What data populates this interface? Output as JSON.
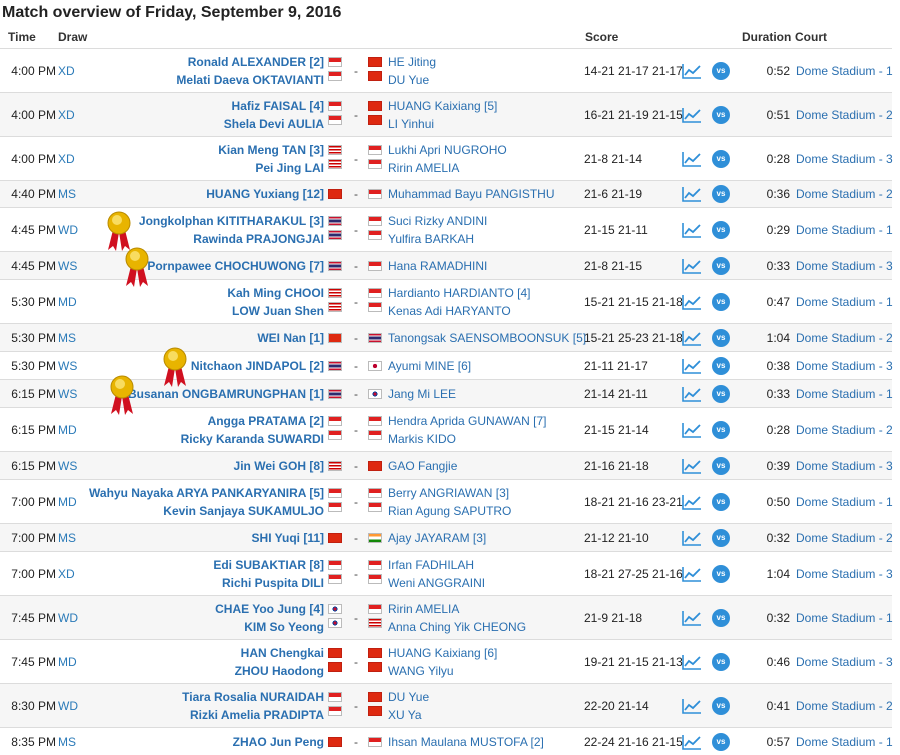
{
  "title": "Match overview of Friday, September 9, 2016",
  "columns": {
    "time": "Time",
    "draw": "Draw",
    "score": "Score",
    "duration": "Duration",
    "court": "Court"
  },
  "vs_label": "vs",
  "separator": "-",
  "colors": {
    "link": "#2a6fb0",
    "vs_badge": "#2f8fd8",
    "stripe": "#f6f6f6",
    "divider": "#dcdcdc",
    "medal_gold": "#e8b400",
    "ribbon": "#d01020"
  },
  "icons": {
    "stats": "line-chart-icon",
    "head_to_head": "vs-icon",
    "winner": "gold-medal-icon"
  },
  "matches": [
    {
      "time": "4:00 PM",
      "draw": "XD",
      "home": [
        {
          "name": "Ronald ALEXANDER [2]",
          "flag": "INA"
        },
        {
          "name": "Melati Daeva OKTAVIANTI",
          "flag": "INA"
        }
      ],
      "away": [
        {
          "name": "HE Jiting",
          "flag": "CHN"
        },
        {
          "name": "DU Yue",
          "flag": "CHN"
        }
      ],
      "score": "14-21 21-17 21-17",
      "duration": "0:52",
      "court": "Dome Stadium - 1"
    },
    {
      "time": "4:00 PM",
      "draw": "XD",
      "home": [
        {
          "name": "Hafiz FAISAL [4]",
          "flag": "INA"
        },
        {
          "name": "Shela Devi AULIA",
          "flag": "INA"
        }
      ],
      "away": [
        {
          "name": "HUANG Kaixiang [5]",
          "flag": "CHN"
        },
        {
          "name": "LI Yinhui",
          "flag": "CHN"
        }
      ],
      "score": "16-21 21-19 21-15",
      "duration": "0:51",
      "court": "Dome Stadium - 2"
    },
    {
      "time": "4:00 PM",
      "draw": "XD",
      "home": [
        {
          "name": "Kian Meng TAN [3]",
          "flag": "MAS"
        },
        {
          "name": "Pei Jing LAI",
          "flag": "MAS"
        }
      ],
      "away": [
        {
          "name": "Lukhi Apri NUGROHO",
          "flag": "INA"
        },
        {
          "name": "Ririn AMELIA",
          "flag": "INA"
        }
      ],
      "score": "21-8 21-14",
      "duration": "0:28",
      "court": "Dome Stadium - 3"
    },
    {
      "time": "4:40 PM",
      "draw": "MS",
      "home": [
        {
          "name": "HUANG Yuxiang [12]",
          "flag": "CHN"
        }
      ],
      "away": [
        {
          "name": "Muhammad Bayu PANGISTHU",
          "flag": "INA"
        }
      ],
      "score": "21-6 21-19",
      "duration": "0:36",
      "court": "Dome Stadium - 2"
    },
    {
      "time": "4:45 PM",
      "draw": "WD",
      "medal": true,
      "home": [
        {
          "name": "Jongkolphan KITITHARAKUL [3]",
          "flag": "THA"
        },
        {
          "name": "Rawinda PRAJONGJAI",
          "flag": "THA"
        }
      ],
      "away": [
        {
          "name": "Suci Rizky ANDINI",
          "flag": "INA"
        },
        {
          "name": "Yulfira BARKAH",
          "flag": "INA"
        }
      ],
      "score": "21-15 21-11",
      "duration": "0:29",
      "court": "Dome Stadium - 1"
    },
    {
      "time": "4:45 PM",
      "draw": "WS",
      "medal": true,
      "home": [
        {
          "name": "Pornpawee CHOCHUWONG [7]",
          "flag": "THA"
        }
      ],
      "away": [
        {
          "name": "Hana RAMADHINI",
          "flag": "INA"
        }
      ],
      "score": "21-8 21-15",
      "duration": "0:33",
      "court": "Dome Stadium - 3"
    },
    {
      "time": "5:30 PM",
      "draw": "MD",
      "home": [
        {
          "name": "Kah Ming CHOOI",
          "flag": "MAS"
        },
        {
          "name": "LOW Juan Shen",
          "flag": "MAS"
        }
      ],
      "away": [
        {
          "name": "Hardianto HARDIANTO [4]",
          "flag": "INA"
        },
        {
          "name": "Kenas Adi HARYANTO",
          "flag": "INA"
        }
      ],
      "score": "15-21 21-15 21-18",
      "duration": "0:47",
      "court": "Dome Stadium - 1"
    },
    {
      "time": "5:30 PM",
      "draw": "MS",
      "home": [
        {
          "name": "WEI Nan [1]",
          "flag": "HKG"
        }
      ],
      "away": [
        {
          "name": "Tanongsak SAENSOMBOONSUK [5]",
          "flag": "THA"
        }
      ],
      "score": "15-21 25-23 21-18",
      "duration": "1:04",
      "court": "Dome Stadium - 2"
    },
    {
      "time": "5:30 PM",
      "draw": "WS",
      "medal": true,
      "home": [
        {
          "name": "Nitchaon JINDAPOL [2]",
          "flag": "THA"
        }
      ],
      "away": [
        {
          "name": "Ayumi MINE [6]",
          "flag": "JPN"
        }
      ],
      "score": "21-11 21-17",
      "duration": "0:38",
      "court": "Dome Stadium - 3"
    },
    {
      "time": "6:15 PM",
      "draw": "WS",
      "medal": true,
      "home": [
        {
          "name": "Busanan ONGBAMRUNGPHAN [1]",
          "flag": "THA"
        }
      ],
      "away": [
        {
          "name": "Jang Mi LEE",
          "flag": "KOR"
        }
      ],
      "score": "21-14 21-11",
      "duration": "0:33",
      "court": "Dome Stadium - 1"
    },
    {
      "time": "6:15 PM",
      "draw": "MD",
      "home": [
        {
          "name": "Angga PRATAMA [2]",
          "flag": "INA"
        },
        {
          "name": "Ricky Karanda SUWARDI",
          "flag": "INA"
        }
      ],
      "away": [
        {
          "name": "Hendra Aprida GUNAWAN [7]",
          "flag": "INA"
        },
        {
          "name": "Markis KIDO",
          "flag": "INA"
        }
      ],
      "score": "21-15 21-14",
      "duration": "0:28",
      "court": "Dome Stadium - 2"
    },
    {
      "time": "6:15 PM",
      "draw": "WS",
      "home": [
        {
          "name": "Jin Wei GOH [8]",
          "flag": "MAS"
        }
      ],
      "away": [
        {
          "name": "GAO Fangjie",
          "flag": "CHN"
        }
      ],
      "score": "21-16 21-18",
      "duration": "0:39",
      "court": "Dome Stadium - 3"
    },
    {
      "time": "7:00 PM",
      "draw": "MD",
      "home": [
        {
          "name": "Wahyu Nayaka ARYA PANKARYANIRA [5]",
          "flag": "INA"
        },
        {
          "name": "Kevin Sanjaya SUKAMULJO",
          "flag": "INA"
        }
      ],
      "away": [
        {
          "name": "Berry ANGRIAWAN [3]",
          "flag": "INA"
        },
        {
          "name": "Rian Agung SAPUTRO",
          "flag": "INA"
        }
      ],
      "score": "18-21 21-16 23-21",
      "duration": "0:50",
      "court": "Dome Stadium - 1"
    },
    {
      "time": "7:00 PM",
      "draw": "MS",
      "home": [
        {
          "name": "SHI Yuqi [11]",
          "flag": "CHN"
        }
      ],
      "away": [
        {
          "name": "Ajay JAYARAM [3]",
          "flag": "IND"
        }
      ],
      "score": "21-12 21-10",
      "duration": "0:32",
      "court": "Dome Stadium - 2"
    },
    {
      "time": "7:00 PM",
      "draw": "XD",
      "home": [
        {
          "name": "Edi SUBAKTIAR [8]",
          "flag": "INA"
        },
        {
          "name": "Richi Puspita DILI",
          "flag": "INA"
        }
      ],
      "away": [
        {
          "name": "Irfan FADHILAH",
          "flag": "INA"
        },
        {
          "name": "Weni ANGGRAINI",
          "flag": "INA"
        }
      ],
      "score": "18-21 27-25 21-16",
      "duration": "1:04",
      "court": "Dome Stadium - 3"
    },
    {
      "time": "7:45 PM",
      "draw": "WD",
      "home": [
        {
          "name": "CHAE Yoo Jung [4]",
          "flag": "KOR"
        },
        {
          "name": "KIM So Yeong",
          "flag": "KOR"
        }
      ],
      "away": [
        {
          "name": "Ririn AMELIA",
          "flag": "INA"
        },
        {
          "name": "Anna Ching Yik CHEONG",
          "flag": "MAS"
        }
      ],
      "score": "21-9 21-18",
      "duration": "0:32",
      "court": "Dome Stadium - 1"
    },
    {
      "time": "7:45 PM",
      "draw": "MD",
      "home": [
        {
          "name": "HAN Chengkai",
          "flag": "CHN"
        },
        {
          "name": "ZHOU Haodong",
          "flag": "CHN"
        }
      ],
      "away": [
        {
          "name": "HUANG Kaixiang [6]",
          "flag": "CHN"
        },
        {
          "name": "WANG Yilyu",
          "flag": "CHN"
        }
      ],
      "score": "19-21 21-15 21-13",
      "duration": "0:46",
      "court": "Dome Stadium - 3"
    },
    {
      "time": "8:30 PM",
      "draw": "WD",
      "home": [
        {
          "name": "Tiara Rosalia NURAIDAH",
          "flag": "INA"
        },
        {
          "name": "Rizki Amelia PRADIPTA",
          "flag": "INA"
        }
      ],
      "away": [
        {
          "name": "DU Yue",
          "flag": "CHN"
        },
        {
          "name": "XU Ya",
          "flag": "CHN"
        }
      ],
      "score": "22-20 21-14",
      "duration": "0:41",
      "court": "Dome Stadium - 2"
    },
    {
      "time": "8:35 PM",
      "draw": "MS",
      "home": [
        {
          "name": "ZHAO Jun Peng",
          "flag": "CHN"
        }
      ],
      "away": [
        {
          "name": "Ihsan Maulana MUSTOFA [2]",
          "flag": "INA"
        }
      ],
      "score": "22-24 21-16 21-15",
      "duration": "0:57",
      "court": "Dome Stadium - 1"
    }
  ]
}
